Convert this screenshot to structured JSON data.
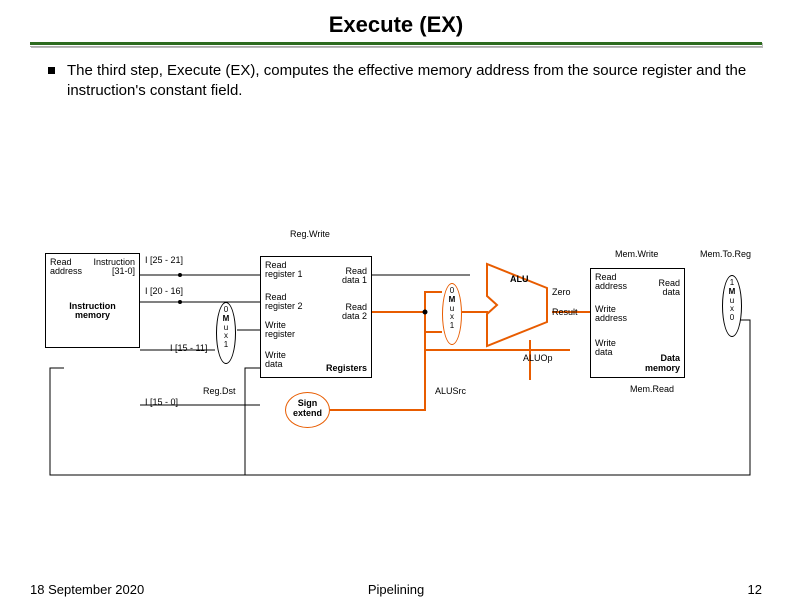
{
  "title": "Execute (EX)",
  "bullet": "The third step, Execute (EX), computes the effective memory address from the source register and the instruction's constant field.",
  "sig": {
    "regwrite": "Reg.Write",
    "memwrite": "Mem.Write",
    "memtoreg": "Mem.To.Reg",
    "regdst": "Reg.Dst",
    "alusrc": "ALUSrc",
    "aluop": "ALUOp",
    "memread": "Mem.Read"
  },
  "ins": {
    "i2521": "I [25 - 21]",
    "i2016": "I [20 - 16]",
    "i1511": "I [15 - 11]",
    "i150": "I [15 - 0]"
  },
  "imem": {
    "read_addr": "Read\naddress",
    "instr": "Instruction\n[31-0]",
    "name": "Instruction\nmemory"
  },
  "regfile": {
    "r1": "Read\nregister 1",
    "r2": "Read\nregister 2",
    "wr": "Write\nregister",
    "wd": "Write\ndata",
    "d1": "Read\ndata 1",
    "d2": "Read\ndata 2",
    "name": "Registers"
  },
  "alu": {
    "name": "ALU",
    "zero": "Zero",
    "result": "Result"
  },
  "dmem": {
    "ra": "Read\naddress",
    "wa": "Write\naddress",
    "wd": "Write\ndata",
    "rd": "Read\ndata",
    "name": "Data\nmemory"
  },
  "mux": {
    "top": "0",
    "bot": "1",
    "m": "M",
    "u": "u",
    "x": "x"
  },
  "signext": "Sign\nextend",
  "footer": {
    "date": "18 September 2020",
    "topic": "Pipelining",
    "page": "12"
  }
}
